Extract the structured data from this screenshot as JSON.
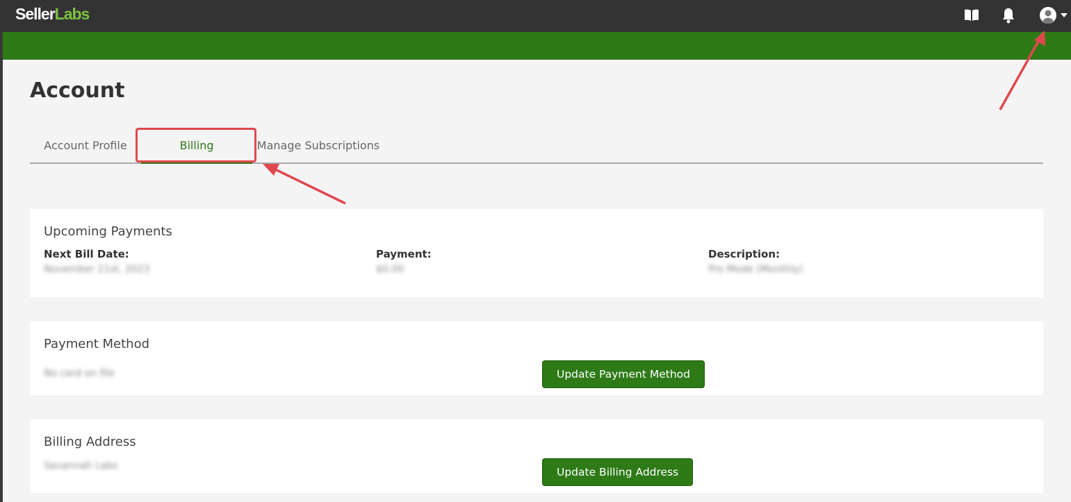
{
  "brand": {
    "name_part1": "Seller",
    "name_part2": "Labs"
  },
  "header": {
    "icons": [
      "book-icon",
      "bell-icon",
      "user-avatar-icon",
      "caret-down-icon"
    ]
  },
  "page": {
    "title": "Account"
  },
  "tabs": [
    {
      "label": "Account Profile",
      "active": false
    },
    {
      "label": "Billing",
      "active": true
    },
    {
      "label": "Manage Subscriptions",
      "active": false
    }
  ],
  "upcoming_payments": {
    "title": "Upcoming Payments",
    "next_bill_date_label": "Next Bill Date:",
    "next_bill_date_value": "November 21st, 2023",
    "payment_label": "Payment:",
    "payment_value": "$0.00",
    "description_label": "Description:",
    "description_value": "Pro Mode (Monthly)"
  },
  "payment_method": {
    "title": "Payment Method",
    "value": "No card on file",
    "button_label": "Update Payment Method"
  },
  "billing_address": {
    "title": "Billing Address",
    "value": "Savannah Labs",
    "button_label": "Update Billing Address"
  },
  "colors": {
    "brand_green": "#2e7a17",
    "topbar": "#333333",
    "annotation_red": "#e0484f"
  }
}
